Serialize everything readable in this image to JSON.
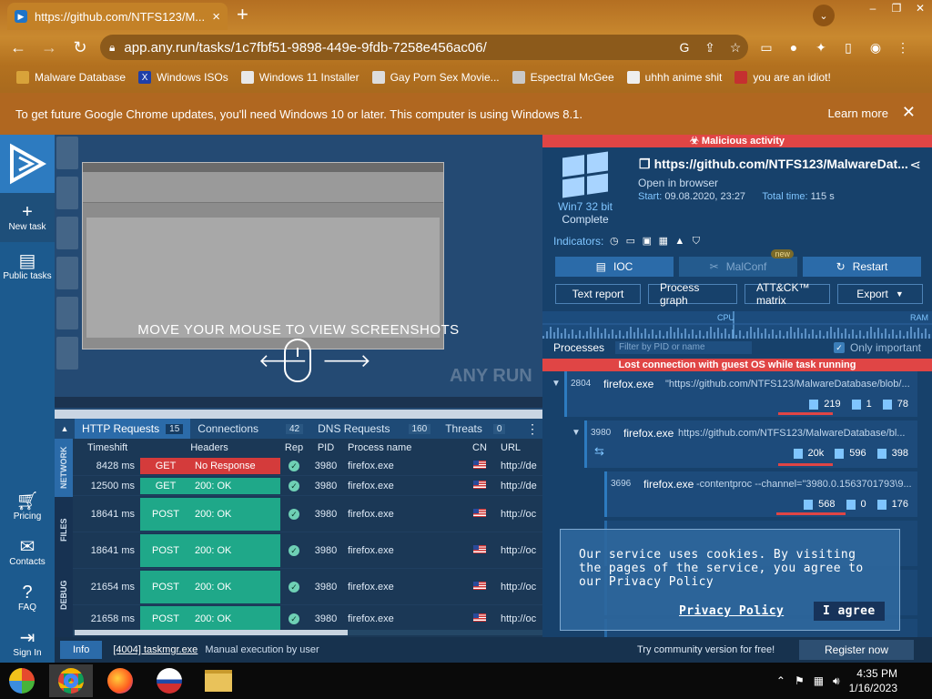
{
  "browser": {
    "tab_title": "https://github.com/NTFS123/M...",
    "url": "app.any.run/tasks/1c7fbf51-9898-449e-9fdb-7258e456ac06/",
    "bookmarks": [
      {
        "label": "Malware Database",
        "icon": "folder-icon"
      },
      {
        "label": "Windows ISOs",
        "icon": "x-icon"
      },
      {
        "label": "Windows 11 Installer",
        "icon": "image-icon"
      },
      {
        "label": "Gay Porn Sex Movie...",
        "icon": "skull-icon"
      },
      {
        "label": "Espectral McGee",
        "icon": "face-icon"
      },
      {
        "label": "uhhh anime shit",
        "icon": "anime-icon"
      },
      {
        "label": "you are an idiot!",
        "icon": "flag-icon"
      }
    ],
    "update_message": "To get future Google Chrome updates, you'll need Windows 10 or later. This computer is using Windows 8.1.",
    "learn_more": "Learn more"
  },
  "sidebar": {
    "items": [
      {
        "label": "New task",
        "icon": "plus-icon"
      },
      {
        "label": "Public tasks",
        "icon": "document-icon"
      },
      {
        "label": "Pricing",
        "icon": "cart-icon"
      },
      {
        "label": "Contacts",
        "icon": "mail-icon"
      },
      {
        "label": "FAQ",
        "icon": "help-icon"
      },
      {
        "label": "Sign In",
        "icon": "signin-icon"
      }
    ]
  },
  "screenshot": {
    "move_text": "MOVE YOUR MOUSE TO VIEW SCREENSHOTS",
    "watermark": "ANY RUN"
  },
  "network": {
    "tabs": [
      {
        "label": "HTTP Requests",
        "count": "15"
      },
      {
        "label": "Connections",
        "count": "42"
      },
      {
        "label": "DNS Requests",
        "count": "160"
      },
      {
        "label": "Threats",
        "count": "0"
      }
    ],
    "side_tabs": [
      "NETWORK",
      "FILES",
      "DEBUG"
    ],
    "columns": [
      "Timeshift",
      "Headers",
      "Rep",
      "PID",
      "Process name",
      "CN",
      "URL"
    ],
    "rows": [
      {
        "time": "8428 ms",
        "method": "GET",
        "status": "No Response",
        "pid": "3980",
        "proc": "firefox.exe",
        "url": "http://de",
        "color": "red"
      },
      {
        "time": "12500 ms",
        "method": "GET",
        "status": "200: OK",
        "pid": "3980",
        "proc": "firefox.exe",
        "url": "http://de",
        "color": "green"
      },
      {
        "time": "18641 ms",
        "method": "POST",
        "status": "200: OK",
        "pid": "3980",
        "proc": "firefox.exe",
        "url": "http://oc",
        "color": "green"
      },
      {
        "time": "18641 ms",
        "method": "POST",
        "status": "200: OK",
        "pid": "3980",
        "proc": "firefox.exe",
        "url": "http://oc",
        "color": "green"
      },
      {
        "time": "21654 ms",
        "method": "POST",
        "status": "200: OK",
        "pid": "3980",
        "proc": "firefox.exe",
        "url": "http://oc",
        "color": "green"
      },
      {
        "time": "21658 ms",
        "method": "POST",
        "status": "200: OK",
        "pid": "3980",
        "proc": "firefox.exe",
        "url": "http://oc",
        "color": "green"
      }
    ]
  },
  "status": {
    "info_tab": "Info",
    "task": "[4004] taskmgr.exe",
    "desc": "Manual execution by user",
    "community": "Try community version for free!",
    "register": "Register now"
  },
  "report": {
    "banner": "Malicious activity",
    "os": "Win7 32 bit",
    "os_status": "Complete",
    "task_url": "https://github.com/NTFS123/MalwareDat...",
    "opened": "Open in browser",
    "start_label": "Start:",
    "start_value": "09.08.2020, 23:27",
    "total_label": "Total time:",
    "total_value": "115 s",
    "indicators_label": "Indicators:",
    "btn_ioc": "IOC",
    "btn_malconf": "MalConf",
    "new_badge": "new",
    "btn_restart": "Restart",
    "btn_text_report": "Text report",
    "btn_process_graph": "Process graph",
    "btn_attck": "ATT&CK™ matrix",
    "btn_export": "Export",
    "cpu_label": "CPU",
    "ram_label": "RAM",
    "processes_label": "Processes",
    "filter_placeholder": "Filter by PID or name",
    "only_important": "Only important",
    "lost_connection": "Lost connection with guest OS while task running",
    "processes": [
      {
        "pid": "2804",
        "name": "firefox.exe",
        "cmd": "\"https://github.com/NTFS123/MalwareDatabase/blob/...",
        "s1": "219",
        "s2": "1",
        "s3": "78"
      },
      {
        "pid": "3980",
        "name": "firefox.exe",
        "cmd": "https://github.com/NTFS123/MalwareDatabase/bl...",
        "s1": "20k",
        "s2": "596",
        "s3": "398"
      },
      {
        "pid": "3696",
        "name": "firefox.exe",
        "cmd": "-contentproc --channel=\"3980.0.1563701793\\9...",
        "s1": "568",
        "s2": "0",
        "s3": "176"
      }
    ]
  },
  "cookie": {
    "text": "Our service uses cookies. By visiting the pages of the service, you agree to our Privacy Policy",
    "link": "Privacy Policy",
    "agree": "I agree"
  },
  "taskbar": {
    "time": "4:35 PM",
    "date": "1/16/2023"
  },
  "colors": {
    "malicious": "#e04545",
    "accent": "#2b6ba9",
    "ok_green": "#1fa889"
  }
}
